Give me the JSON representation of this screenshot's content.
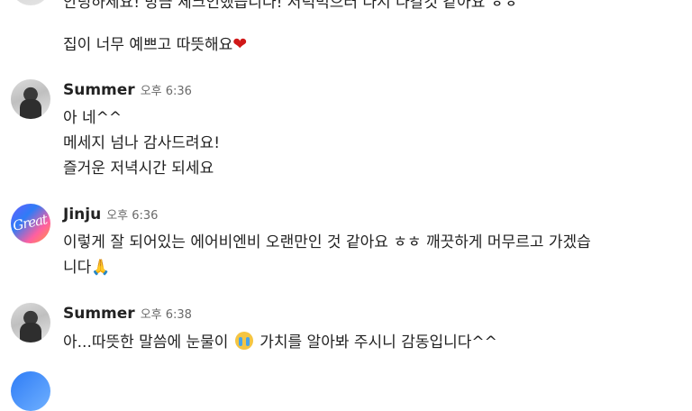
{
  "messages_top": {
    "partial_line": "안녕하세요! 방금 체크인했습니다! 저녁먹으러 다시 나갈것 같아요 ㅎㅎ",
    "line2_text": "집이 너무 예쁘고 따뜻해요",
    "line2_emoji": "❤"
  },
  "msg1": {
    "sender": "Summer",
    "time": "오후 6:36",
    "lines": [
      "아 네^^",
      "메세지 넘나 감사드려요!",
      "즐거운 저녁시간 되세요"
    ]
  },
  "msg2": {
    "sender": "Jinju",
    "time": "오후 6:36",
    "avatar_text": "Great",
    "lines": [
      "이렇게 잘 되어있는 에어비엔비 오랜만인 것 같아요 ㅎㅎ 깨끗하게 머무르고 가겠습",
      "니다🙏"
    ]
  },
  "msg3": {
    "sender": "Summer",
    "time": "오후 6:38",
    "text_before": "아...따뜻한 말씀에 눈물이",
    "emoji": "crying-face",
    "text_after": "가치를 알아봐 주시니 감동입니다^^"
  }
}
